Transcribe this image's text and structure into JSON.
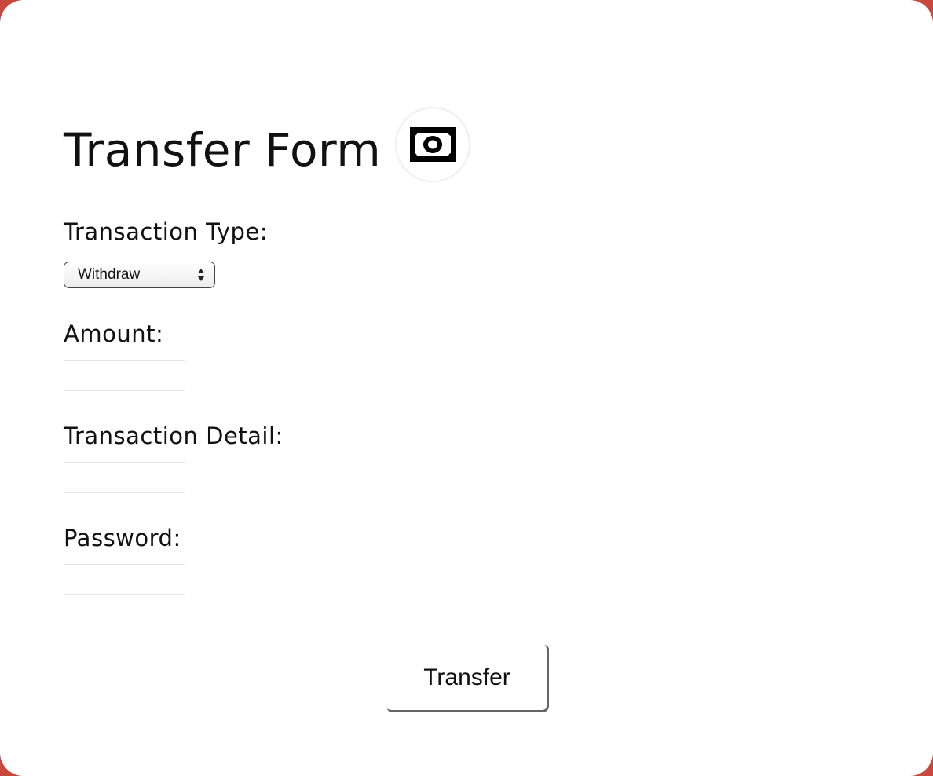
{
  "form": {
    "title": "Transfer Form",
    "icon": "money-bill-icon",
    "transaction_type": {
      "label": "Transaction Type:",
      "selected": "Withdraw"
    },
    "amount": {
      "label": "Amount:",
      "value": ""
    },
    "transaction_detail": {
      "label": "Transaction Detail:",
      "value": ""
    },
    "password": {
      "label": "Password:",
      "value": ""
    },
    "submit_label": "Transfer"
  },
  "colors": {
    "frame": "#c8473f",
    "card": "#ffffff",
    "text": "#111111"
  }
}
